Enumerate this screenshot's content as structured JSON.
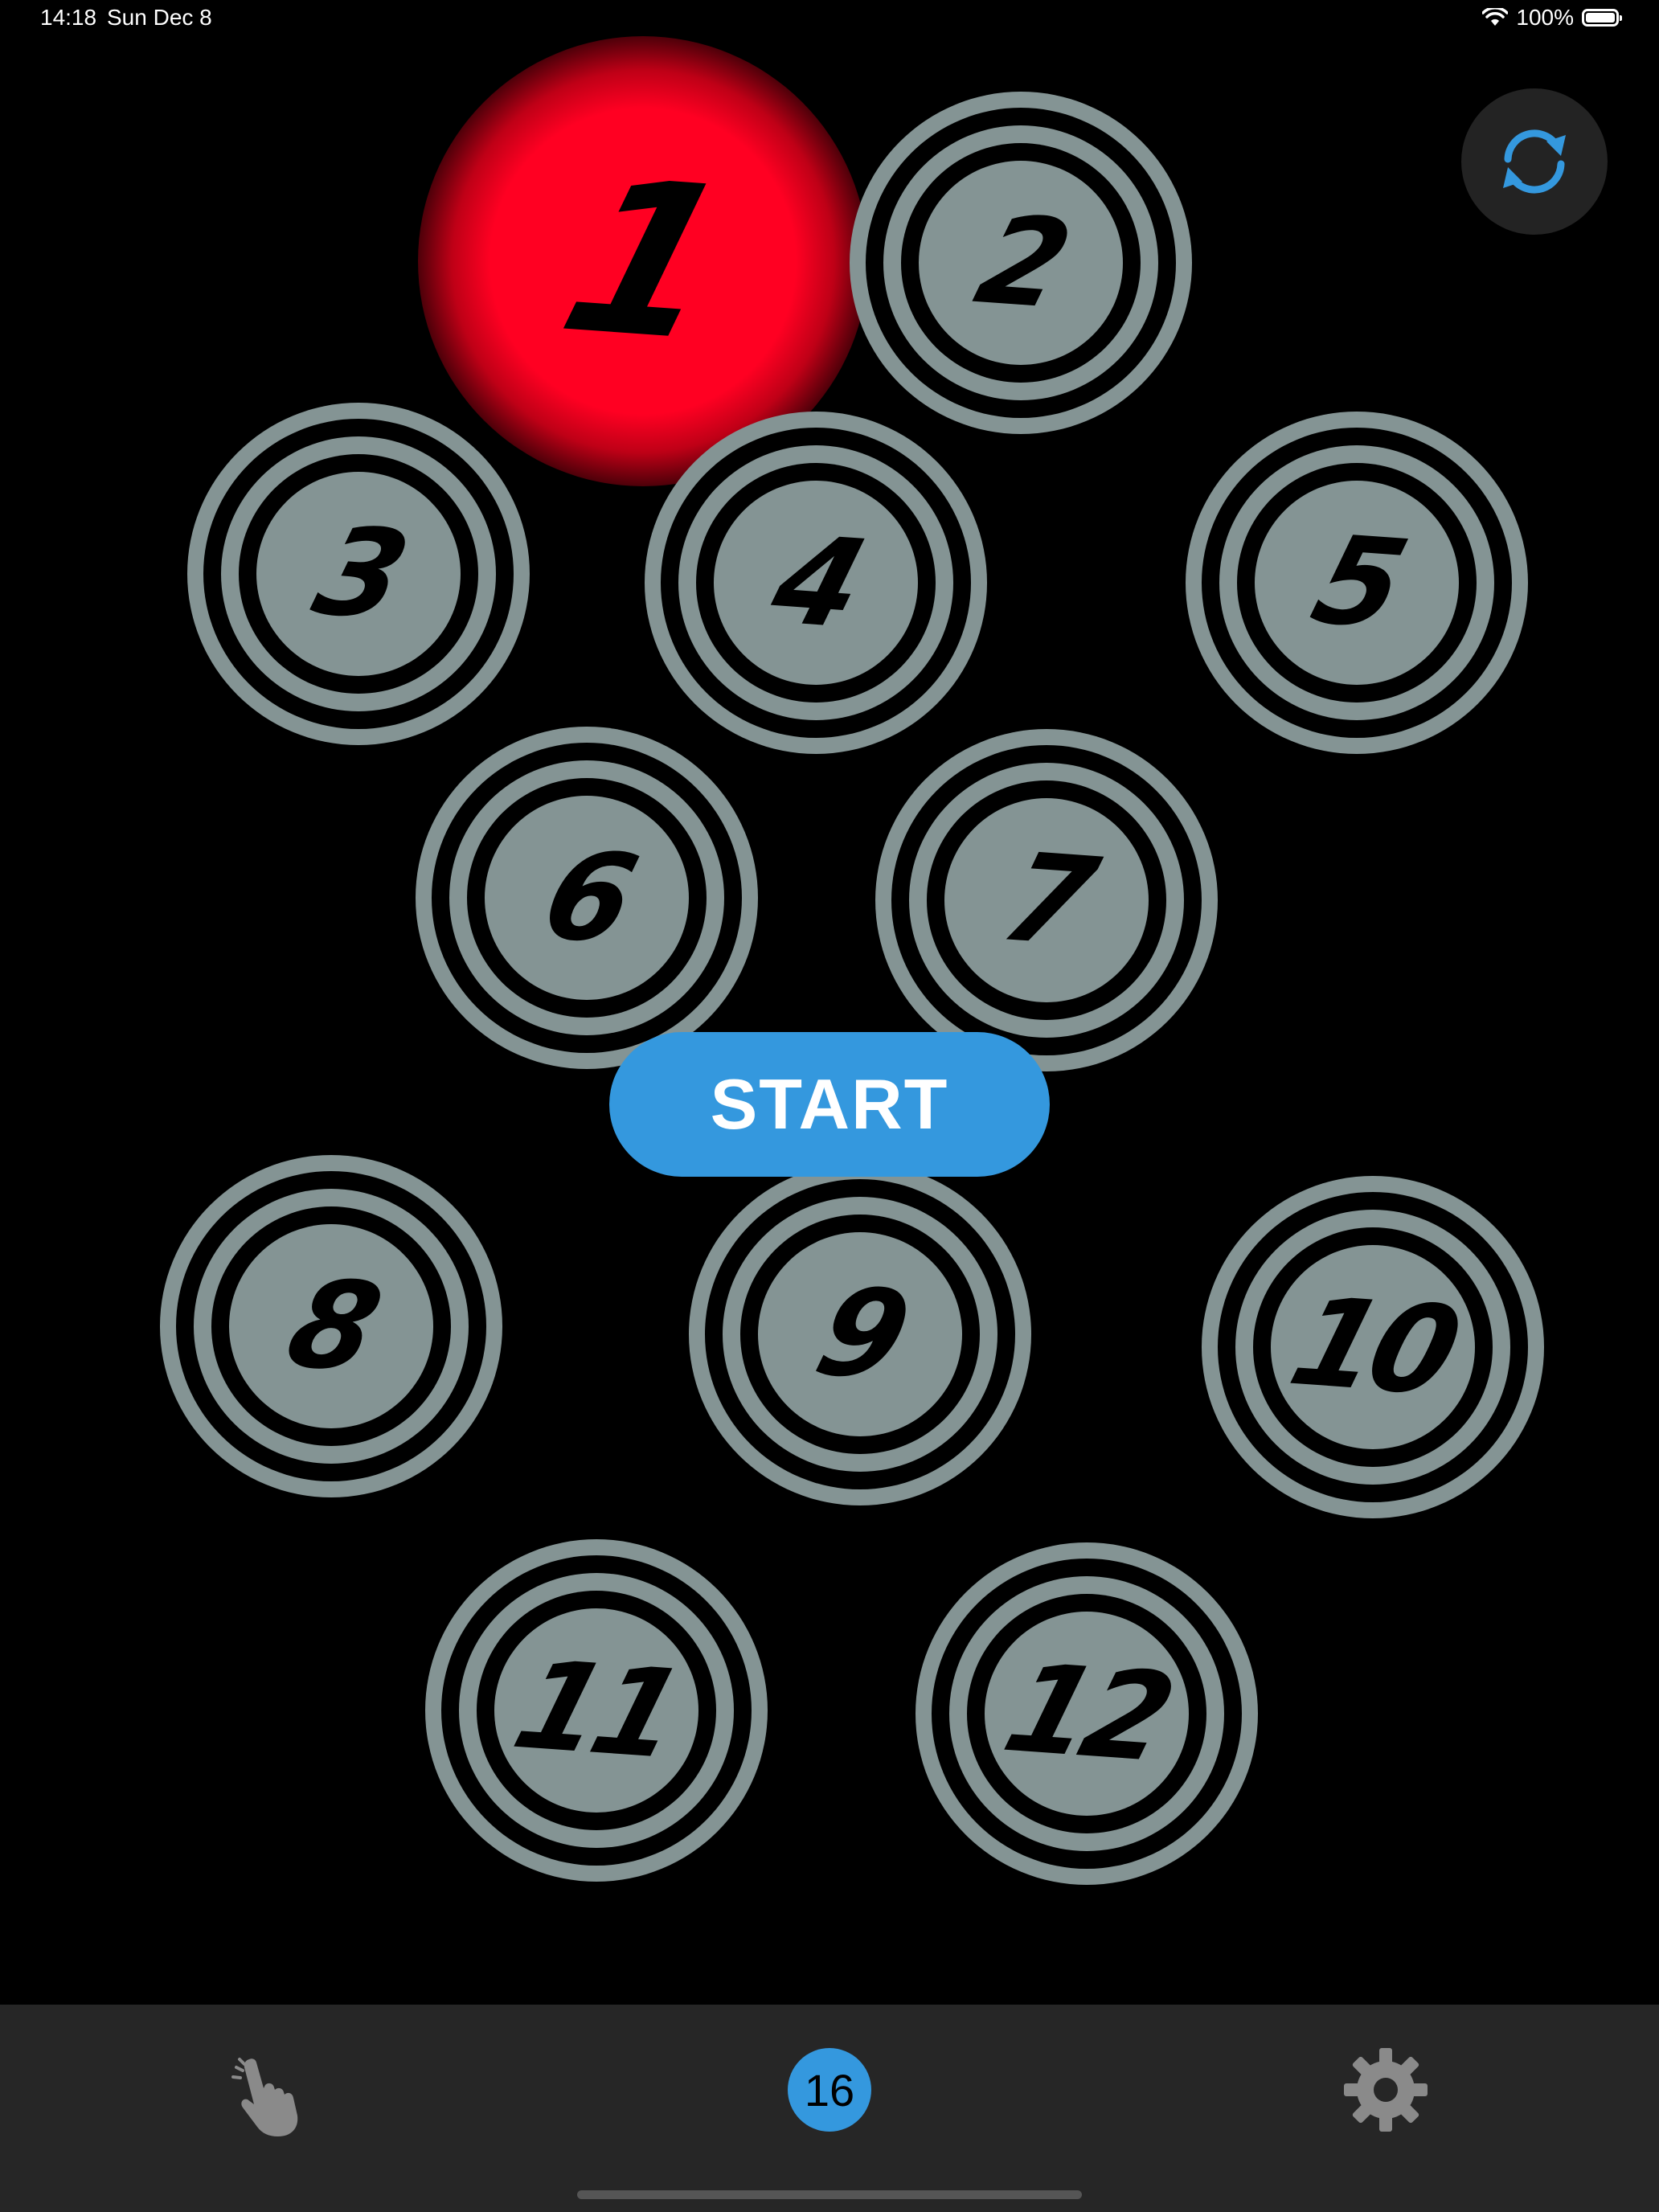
{
  "status_bar": {
    "time": "14:18",
    "date": "Sun Dec 8",
    "battery": "100%"
  },
  "tokens": [
    {
      "label": "1",
      "active": true
    },
    {
      "label": "2"
    },
    {
      "label": "3"
    },
    {
      "label": "4"
    },
    {
      "label": "5"
    },
    {
      "label": "6"
    },
    {
      "label": "7"
    },
    {
      "label": "8"
    },
    {
      "label": "9"
    },
    {
      "label": "10"
    },
    {
      "label": "11"
    },
    {
      "label": "12"
    }
  ],
  "start_label": "START",
  "toolbar": {
    "counter": "16"
  },
  "colors": {
    "accent": "#3498de",
    "token_gray": "#849494",
    "active_red": "#ff0022",
    "toolbar_bg": "#262626"
  }
}
